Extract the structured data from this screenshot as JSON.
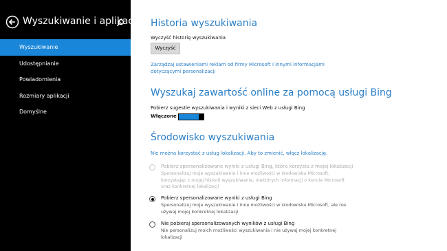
{
  "sidebar": {
    "title": "Wyszukiwanie i aplikacje",
    "items": [
      {
        "label": "Wyszukiwanie"
      },
      {
        "label": "Udostępnianie"
      },
      {
        "label": "Powiadomienia"
      },
      {
        "label": "Rozmiary aplikacji"
      },
      {
        "label": "Domyślne"
      }
    ]
  },
  "history": {
    "heading": "Historia wyszukiwania",
    "clear_label": "Wyczyść historię wyszukiwania",
    "clear_button": "Wyczyść",
    "link": "Zarządzaj ustawieniami reklam od firmy Microsoft i innymi informacjami dotyczącymi personalizacji"
  },
  "bing": {
    "heading": "Wyszukaj zawartość online za pomocą usługi Bing",
    "label": "Pobierz sugestie wyszukiwania i wyniki z sieci Web z usługi Bing",
    "toggle_state": "Włączone"
  },
  "environment": {
    "heading": "Środowisko wyszukiwania",
    "notice": "Nie można korzystać z usług lokalizacji. Aby to zmienić, włącz lokalizację.",
    "options": [
      {
        "title": "Pobierz spersonalizowane wyniki z usługi Bing, która korzysta z mojej lokalizacji",
        "desc": "Spersonalizuj moje wyszukiwanie i inne możliwości w środowisku Microsoft, korzystając z mojej historii wyszukiwania, niektórych informacji o koncie Microsoft oraz konkretnej lokalizacji"
      },
      {
        "title": "Pobierz spersonalizowane wyniki z usługi Bing",
        "desc": "Spersonalizuj moje wyszukiwanie i inne możliwości w środowisku Microsoft, ale nie używaj mojej konkretnej lokalizacji"
      },
      {
        "title": "Nie pobieraj spersonalizowanych wyników z usługi Bing",
        "desc": "Nie personalizuj moich możliwości wyszukiwania i nie używaj mojej konkretnej lokalizacji"
      }
    ]
  },
  "colors": {
    "accent": "#1a86d9",
    "heading": "#2b7fc6",
    "sidebar_bg": "#000000"
  }
}
